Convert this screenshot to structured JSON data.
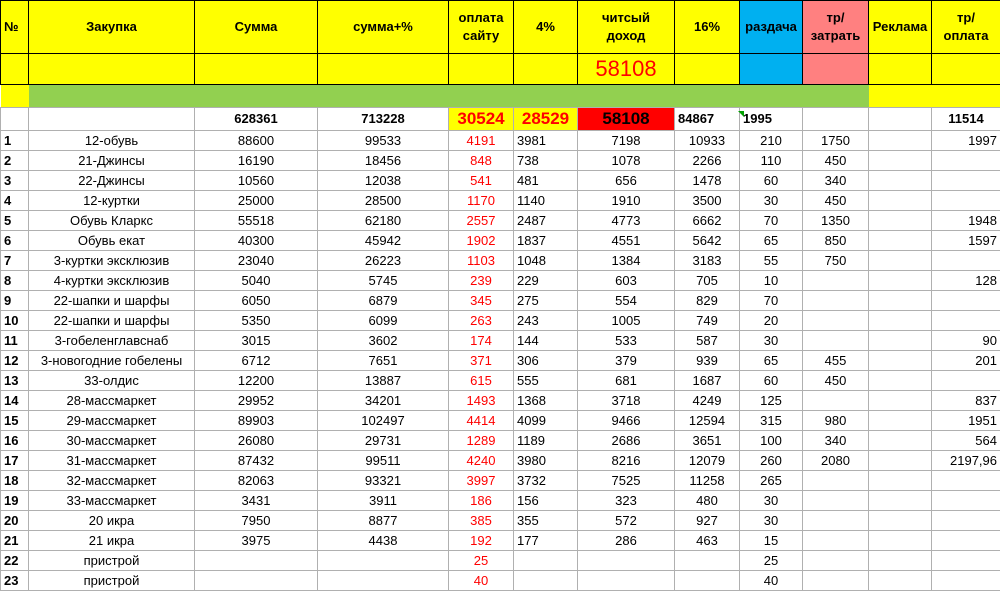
{
  "headers": {
    "no": "№",
    "zakupka": "Закупка",
    "summa": "Сумма",
    "summa_pct": "сумма+%",
    "oplata": "оплата сайту",
    "pct4": "4%",
    "chist": "читсый доход",
    "pct16": "16%",
    "razdacha": "раздача",
    "tr_zatrat": "тр/затрать",
    "reklama": "Реклама",
    "tr_oplata": "тр/оплата"
  },
  "highlight_value": "58108",
  "totals": {
    "summa": "628361",
    "summa_pct": "713228",
    "oplata": "30524",
    "pct4": "28529",
    "chist": "58108",
    "pct16": "84867",
    "razdacha": "1995",
    "tr_oplata": "11514"
  },
  "colors": {
    "header_yellow": "#ffff00",
    "razdacha_blue": "#00b0f0",
    "zatrat_pink": "#ff8080",
    "green_bar": "#92d050",
    "red_cell": "#ff0000",
    "red_text": "#ff0000"
  },
  "rows": [
    {
      "n": "1",
      "name": "12-обувь",
      "summa": "88600",
      "summa_pct": "99533",
      "oplata": "4191",
      "pct4": "3981",
      "chist": "7198",
      "pct16": "10933",
      "razdacha": "210",
      "zatrat": "1750",
      "reklama": "",
      "tr_oplata": "1997"
    },
    {
      "n": "2",
      "name": "21-Джинсы",
      "summa": "16190",
      "summa_pct": "18456",
      "oplata": "848",
      "pct4": "738",
      "chist": "1078",
      "pct16": "2266",
      "razdacha": "110",
      "zatrat": "450",
      "reklama": "",
      "tr_oplata": ""
    },
    {
      "n": "3",
      "name": "22-Джинсы",
      "summa": "10560",
      "summa_pct": "12038",
      "oplata": "541",
      "pct4": "481",
      "chist": "656",
      "pct16": "1478",
      "razdacha": "60",
      "zatrat": "340",
      "reklama": "",
      "tr_oplata": ""
    },
    {
      "n": "4",
      "name": "12-куртки",
      "summa": "25000",
      "summa_pct": "28500",
      "oplata": "1170",
      "pct4": "1140",
      "chist": "1910",
      "pct16": "3500",
      "razdacha": "30",
      "zatrat": "450",
      "reklama": "",
      "tr_oplata": ""
    },
    {
      "n": "5",
      "name": "Обувь Кларкс",
      "summa": "55518",
      "summa_pct": "62180",
      "oplata": "2557",
      "pct4": "2487",
      "chist": "4773",
      "pct16": "6662",
      "razdacha": "70",
      "zatrat": "1350",
      "reklama": "",
      "tr_oplata": "1948"
    },
    {
      "n": "6",
      "name": "Обувь екат",
      "summa": "40300",
      "summa_pct": "45942",
      "oplata": "1902",
      "pct4": "1837",
      "chist": "4551",
      "pct16": "5642",
      "razdacha": "65",
      "zatrat": "850",
      "reklama": "",
      "tr_oplata": "1597"
    },
    {
      "n": "7",
      "name": "3-куртки эксклюзив",
      "summa": "23040",
      "summa_pct": "26223",
      "oplata": "1103",
      "pct4": "1048",
      "chist": "1384",
      "pct16": "3183",
      "razdacha": "55",
      "zatrat": "750",
      "reklama": "",
      "tr_oplata": ""
    },
    {
      "n": "8",
      "name": "4-куртки  эксклюзив",
      "summa": "5040",
      "summa_pct": "5745",
      "oplata": "239",
      "pct4": "229",
      "chist": "603",
      "pct16": "705",
      "razdacha": "10",
      "zatrat": "",
      "reklama": "",
      "tr_oplata": "128"
    },
    {
      "n": "9",
      "name": "22-шапки и шарфы",
      "summa": "6050",
      "summa_pct": "6879",
      "oplata": "345",
      "pct4": "275",
      "chist": "554",
      "pct16": "829",
      "razdacha": "70",
      "zatrat": "",
      "reklama": "",
      "tr_oplata": ""
    },
    {
      "n": "10",
      "name": "22-шапки и шарфы",
      "summa": "5350",
      "summa_pct": "6099",
      "oplata": "263",
      "pct4": "243",
      "chist": "1005",
      "pct16": "749",
      "razdacha": "20",
      "zatrat": "",
      "reklama": "",
      "tr_oplata": ""
    },
    {
      "n": "11",
      "name": "3-гобеленглавснаб",
      "summa": "3015",
      "summa_pct": "3602",
      "oplata": "174",
      "pct4": "144",
      "chist": "533",
      "pct16": "587",
      "razdacha": "30",
      "zatrat": "",
      "reklama": "",
      "tr_oplata": "90"
    },
    {
      "n": "12",
      "name": "3-новогодние гобелены",
      "summa": "6712",
      "summa_pct": "7651",
      "oplata": "371",
      "pct4": "306",
      "chist": "379",
      "pct16": "939",
      "razdacha": "65",
      "zatrat": "455",
      "reklama": "",
      "tr_oplata": "201"
    },
    {
      "n": "13",
      "name": "33-олдис",
      "summa": "12200",
      "summa_pct": "13887",
      "oplata": "615",
      "pct4": "555",
      "chist": "681",
      "pct16": "1687",
      "razdacha": "60",
      "zatrat": "450",
      "reklama": "",
      "tr_oplata": ""
    },
    {
      "n": "14",
      "name": "28-массмаркет",
      "summa": "29952",
      "summa_pct": "34201",
      "oplata": "1493",
      "pct4": "1368",
      "chist": "3718",
      "pct16": "4249",
      "razdacha": "125",
      "zatrat": "",
      "reklama": "",
      "tr_oplata": "837"
    },
    {
      "n": "15",
      "name": "29-массмаркет",
      "summa": "89903",
      "summa_pct": "102497",
      "oplata": "4414",
      "pct4": "4099",
      "chist": "9466",
      "pct16": "12594",
      "razdacha": "315",
      "zatrat": "980",
      "reklama": "",
      "tr_oplata": "1951"
    },
    {
      "n": "16",
      "name": "30-массмаркет",
      "summa": "26080",
      "summa_pct": "29731",
      "oplata": "1289",
      "pct4": "1189",
      "chist": "2686",
      "pct16": "3651",
      "razdacha": "100",
      "zatrat": "340",
      "reklama": "",
      "tr_oplata": "564"
    },
    {
      "n": "17",
      "name": "31-массмаркет",
      "summa": "87432",
      "summa_pct": "99511",
      "oplata": "4240",
      "pct4": "3980",
      "chist": "8216",
      "pct16": "12079",
      "razdacha": "260",
      "zatrat": "2080",
      "reklama": "",
      "tr_oplata": "2197,96"
    },
    {
      "n": "18",
      "name": "32-массмаркет",
      "summa": "82063",
      "summa_pct": "93321",
      "oplata": "3997",
      "pct4": "3732",
      "chist": "7525",
      "pct16": "11258",
      "razdacha": "265",
      "zatrat": "",
      "reklama": "",
      "tr_oplata": ""
    },
    {
      "n": "19",
      "name": "33-массмаркет",
      "summa": "3431",
      "summa_pct": "3911",
      "oplata": "186",
      "pct4": "156",
      "chist": "323",
      "pct16": "480",
      "razdacha": "30",
      "zatrat": "",
      "reklama": "",
      "tr_oplata": ""
    },
    {
      "n": "20",
      "name": "20 икра",
      "summa": "7950",
      "summa_pct": "8877",
      "oplata": "385",
      "pct4": "355",
      "chist": "572",
      "pct16": "927",
      "razdacha": "30",
      "zatrat": "",
      "reklama": "",
      "tr_oplata": ""
    },
    {
      "n": "21",
      "name": "21 икра",
      "summa": "3975",
      "summa_pct": "4438",
      "oplata": "192",
      "pct4": "177",
      "chist": "286",
      "pct16": "463",
      "razdacha": "15",
      "zatrat": "",
      "reklama": "",
      "tr_oplata": ""
    },
    {
      "n": "22",
      "name": "пристрой",
      "summa": "",
      "summa_pct": "",
      "oplata": "25",
      "pct4": "",
      "chist": "",
      "pct16": "",
      "razdacha": "25",
      "zatrat": "",
      "reklama": "",
      "tr_oplata": ""
    },
    {
      "n": "23",
      "name": "пристрой",
      "summa": "",
      "summa_pct": "",
      "oplata": "40",
      "pct4": "",
      "chist": "",
      "pct16": "",
      "razdacha": "40",
      "zatrat": "",
      "reklama": "",
      "tr_oplata": ""
    }
  ]
}
